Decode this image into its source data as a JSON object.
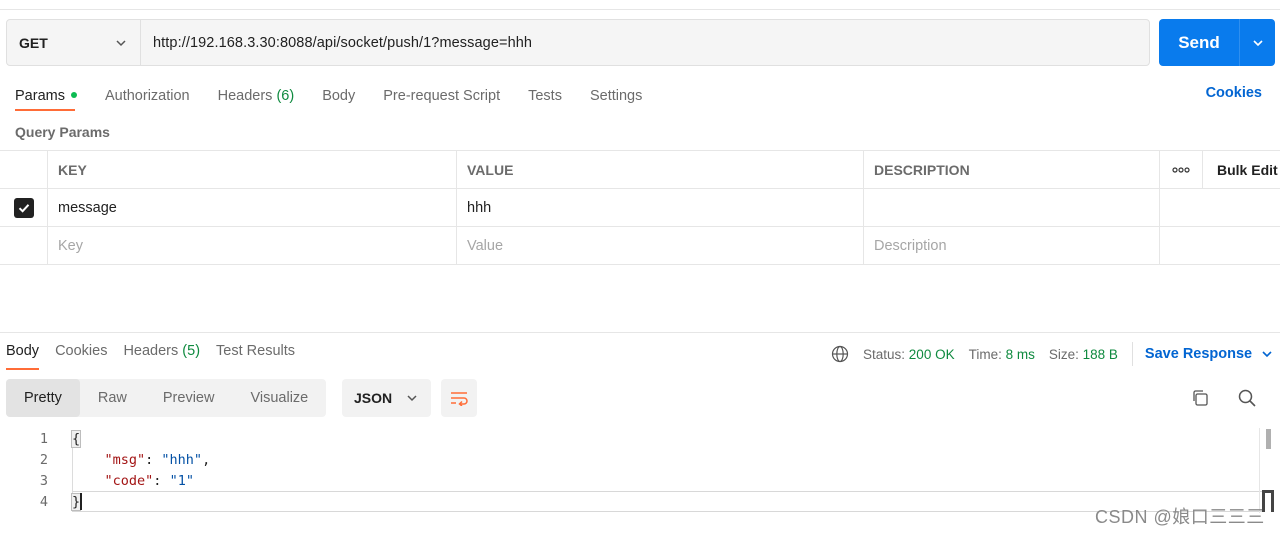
{
  "request": {
    "method": "GET",
    "url": "http://192.168.3.30:8088/api/socket/push/1?message=hhh",
    "send_label": "Send"
  },
  "request_tabs": [
    {
      "label": "Params",
      "count": "",
      "active": true
    },
    {
      "label": "Authorization",
      "count": ""
    },
    {
      "label": "Headers",
      "count": "(6)"
    },
    {
      "label": "Body",
      "count": ""
    },
    {
      "label": "Pre-request Script",
      "count": ""
    },
    {
      "label": "Tests",
      "count": ""
    },
    {
      "label": "Settings",
      "count": ""
    }
  ],
  "cookies_label": "Cookies",
  "query_params": {
    "title": "Query Params",
    "headers": {
      "key": "KEY",
      "value": "VALUE",
      "description": "DESCRIPTION",
      "more": "ooo",
      "bulk_edit": "Bulk Edit"
    },
    "rows": [
      {
        "checked": true,
        "key": "message",
        "value": "hhh",
        "description": ""
      }
    ],
    "placeholders": {
      "key": "Key",
      "value": "Value",
      "description": "Description"
    }
  },
  "response": {
    "tabs": [
      {
        "label": "Body",
        "count": "",
        "active": true
      },
      {
        "label": "Cookies",
        "count": ""
      },
      {
        "label": "Headers",
        "count": "(5)"
      },
      {
        "label": "Test Results",
        "count": ""
      }
    ],
    "status_label": "Status:",
    "status_value": "200 OK",
    "time_label": "Time:",
    "time_value": "8 ms",
    "size_label": "Size:",
    "size_value": "188 B",
    "save_label": "Save Response",
    "view_modes": [
      "Pretty",
      "Raw",
      "Preview",
      "Visualize"
    ],
    "active_view": "Pretty",
    "format": "JSON",
    "code_lines": [
      "1",
      "2",
      "3",
      "4"
    ],
    "json": {
      "open": "{",
      "key1": "\"msg\"",
      "val1": "\"hhh\"",
      "key2": "\"code\"",
      "val2": "\"1\"",
      "close": "}"
    }
  },
  "watermark": "CSDN @娘口三三三",
  "colors": {
    "accent": "#ff6c37",
    "send": "#097bed",
    "link": "#0265d2",
    "success": "#0f8a3f"
  }
}
